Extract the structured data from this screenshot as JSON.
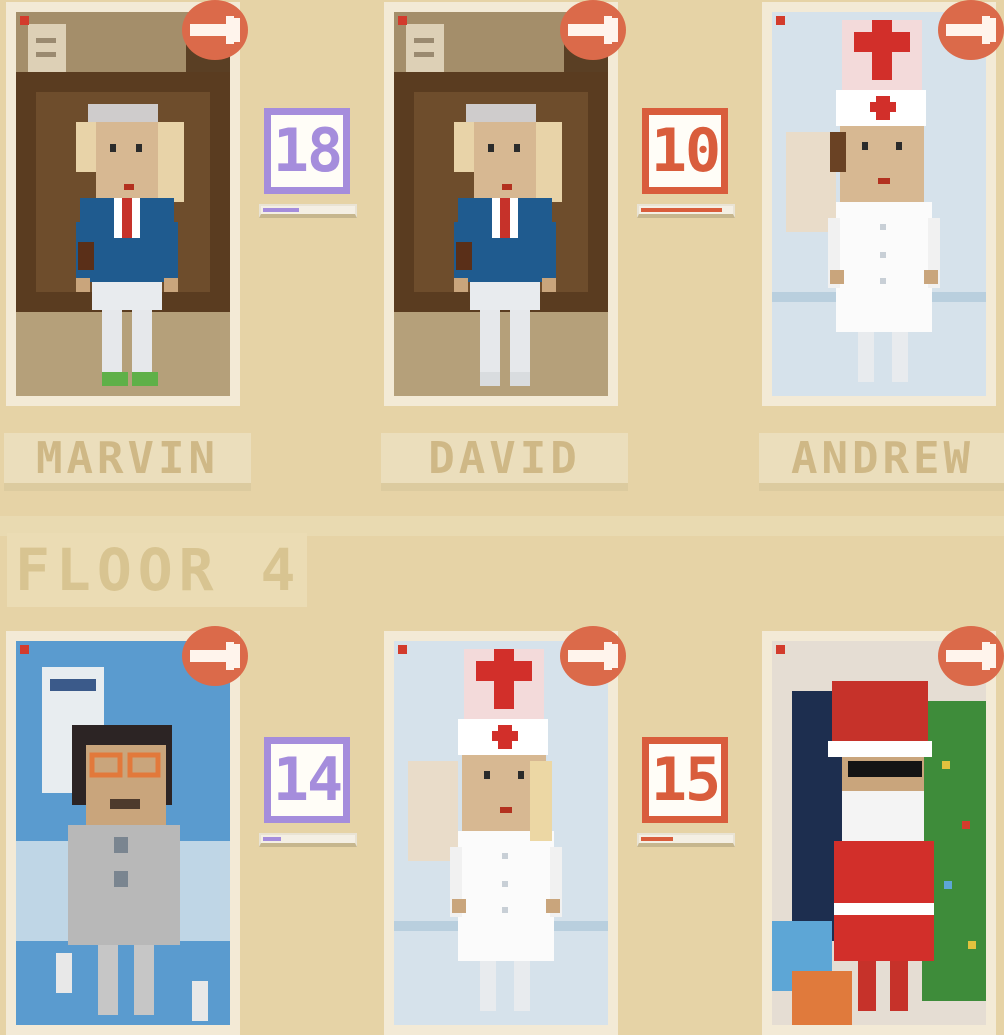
{
  "floor": {
    "label": "FLOOR 4"
  },
  "top_row": [
    {
      "name": "MARVIN",
      "level": "18",
      "level_color": "purple",
      "progress": 0.4,
      "character": "businessman",
      "background": "office"
    },
    {
      "name": "DAVID",
      "level": "10",
      "level_color": "red",
      "progress": 0.9,
      "character": "businessman",
      "background": "office"
    },
    {
      "name": "ANDREW",
      "level": null,
      "character": "nurse",
      "background": "hospital"
    }
  ],
  "bottom_row": [
    {
      "name": null,
      "level": "14",
      "level_color": "purple",
      "progress": 0.2,
      "character": "scientist",
      "background": "lab"
    },
    {
      "name": null,
      "level": "15",
      "level_color": "red",
      "progress": 0.35,
      "character": "nurse",
      "background": "hospital"
    },
    {
      "name": null,
      "level": null,
      "character": "santa",
      "background": "christmas"
    }
  ],
  "icons": {
    "remove": "wrench-remove-icon"
  },
  "colors": {
    "purple": "#a58ddc",
    "red": "#d95d3c",
    "background": "#e6d3a6"
  }
}
